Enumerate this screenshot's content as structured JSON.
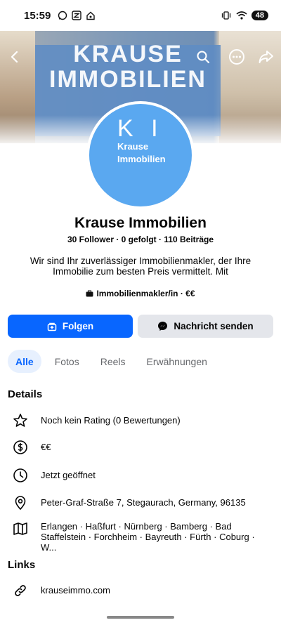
{
  "status_bar": {
    "time": "15:59",
    "battery": "48"
  },
  "cover": {
    "line1": "KRAUSE",
    "line2": "IMMOBILIEN"
  },
  "avatar": {
    "initials": "K I",
    "line1": "Krause",
    "line2": "Immobilien"
  },
  "profile": {
    "name": "Krause Immobilien",
    "stats": "30 Follower · 0 gefolgt · 110 Beiträge",
    "bio": "Wir sind Ihr zuverlässiger Immobilienmakler, der Ihre Immobilie zum besten Preis vermittelt. Mit",
    "category": "Immobilienmakler/in · €€"
  },
  "actions": {
    "follow": "Folgen",
    "message": "Nachricht senden"
  },
  "tabs": [
    {
      "label": "Alle",
      "active": true
    },
    {
      "label": "Fotos",
      "active": false
    },
    {
      "label": "Reels",
      "active": false
    },
    {
      "label": "Erwähnungen",
      "active": false
    }
  ],
  "details": {
    "title": "Details",
    "items": [
      {
        "icon": "star-icon",
        "text": "Noch kein Rating (0 Bewertungen)"
      },
      {
        "icon": "dollar-icon",
        "text": "€€"
      },
      {
        "icon": "clock-icon",
        "text": "Jetzt geöffnet"
      },
      {
        "icon": "location-pin-icon",
        "text": "Peter-Graf-Straße 7, Stegaurach, Germany, 96135"
      },
      {
        "icon": "map-icon",
        "text": "Erlangen · Haßfurt · Nürnberg · Bamberg · Bad Staffelstein · Forchheim · Bayreuth · Fürth · Coburg · W..."
      }
    ]
  },
  "links": {
    "title": "Links",
    "items": [
      {
        "icon": "link-icon",
        "text": "krauseimmo.com"
      }
    ]
  },
  "colors": {
    "accent": "#0866ff",
    "tab_active_bg": "#e7f0fe",
    "avatar_bg": "#5aa8f0",
    "secondary_button": "#e4e6eb"
  }
}
